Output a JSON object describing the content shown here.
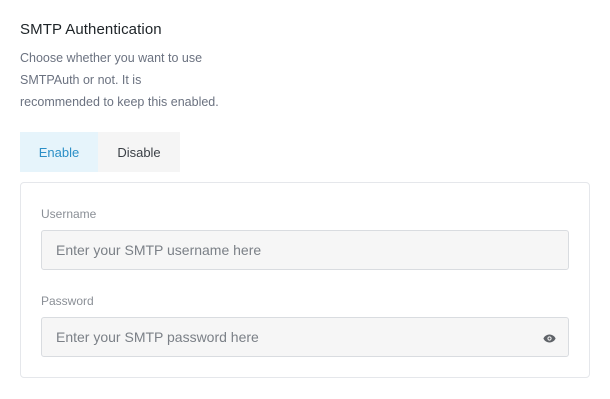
{
  "section": {
    "title": "SMTP Authentication",
    "description_lines": [
      "Choose whether you want to use",
      "SMTPAuth or not. It is",
      "recommended to keep this enabled."
    ]
  },
  "toggle": {
    "enable_label": "Enable",
    "disable_label": "Disable",
    "selected": "Enable"
  },
  "credentials": {
    "username_label": "Username",
    "username_placeholder": "Enter your SMTP username here",
    "username_value": "",
    "password_label": "Password",
    "password_placeholder": "Enter your SMTP password here",
    "password_value": ""
  },
  "icons": {
    "password_toggle": "eye-icon"
  },
  "colors": {
    "accent": "#2b8fc7",
    "accent_bg": "#e6f4fb"
  }
}
